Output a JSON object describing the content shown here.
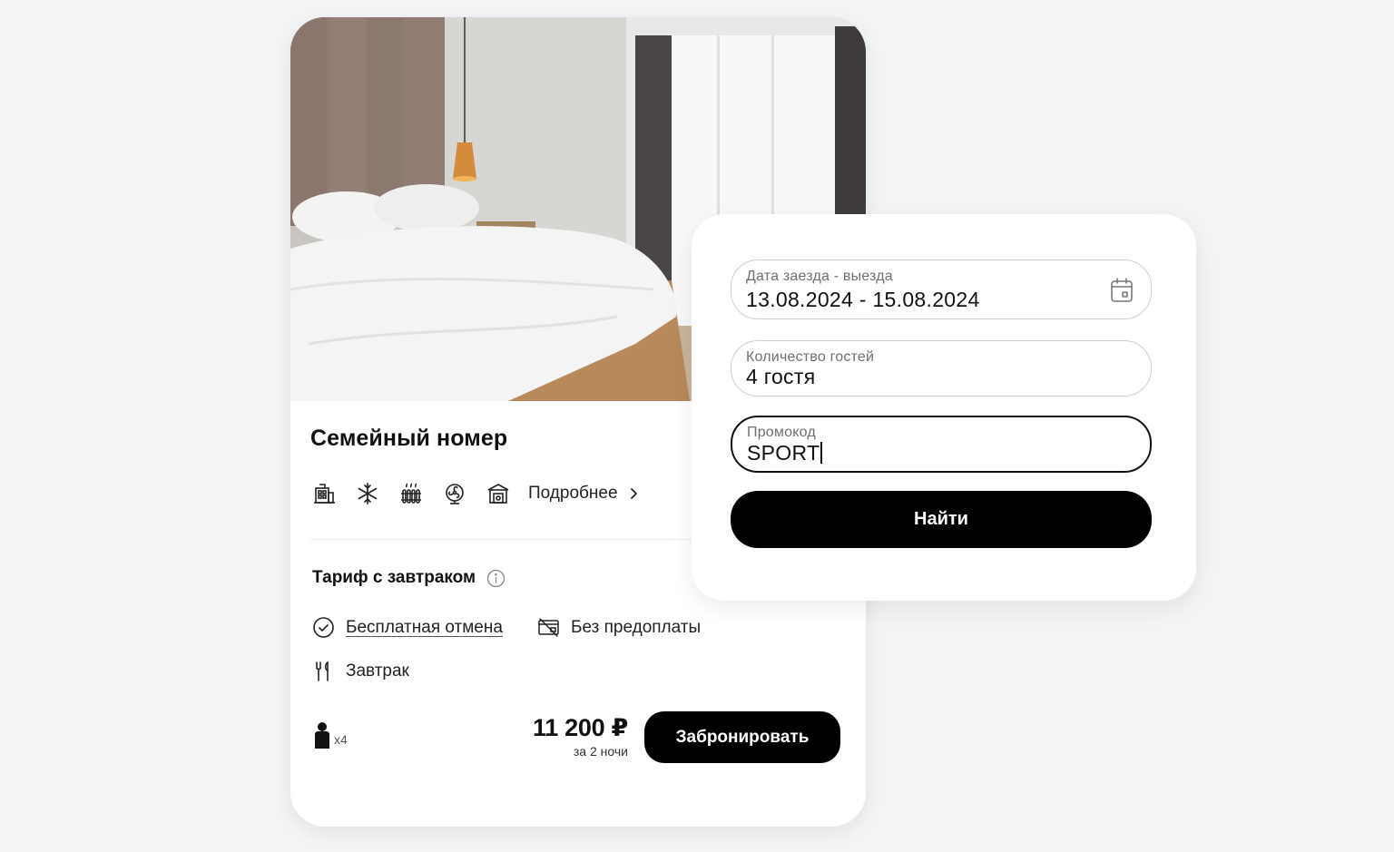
{
  "room": {
    "title": "Семейный номер",
    "details_link": "Подробнее",
    "amenity_icons": [
      "building-icon",
      "snowflake-icon",
      "radiator-icon",
      "fan-icon",
      "safe-icon"
    ],
    "tariff": {
      "title": "Тариф с завтраком",
      "features": {
        "free_cancellation": "Бесплатная отмена",
        "no_prepayment": "Без предоплаты",
        "breakfast": "Завтрак"
      }
    },
    "guests_multiplier": "x4",
    "price": "11 200 ₽",
    "price_note": "за 2 ночи",
    "book_button": "Забронировать"
  },
  "search": {
    "dates": {
      "label": "Дата заезда - выезда",
      "value": "13.08.2024 - 15.08.2024"
    },
    "guests": {
      "label": "Количество гостей",
      "value": "4 гостя"
    },
    "promo": {
      "label": "Промокод",
      "value": "SPORT"
    },
    "submit_button": "Найти"
  },
  "colors": {
    "background": "#f3f4f6",
    "card": "#ffffff",
    "primary_button": "#000000",
    "field_border": "#cfcfcf"
  }
}
